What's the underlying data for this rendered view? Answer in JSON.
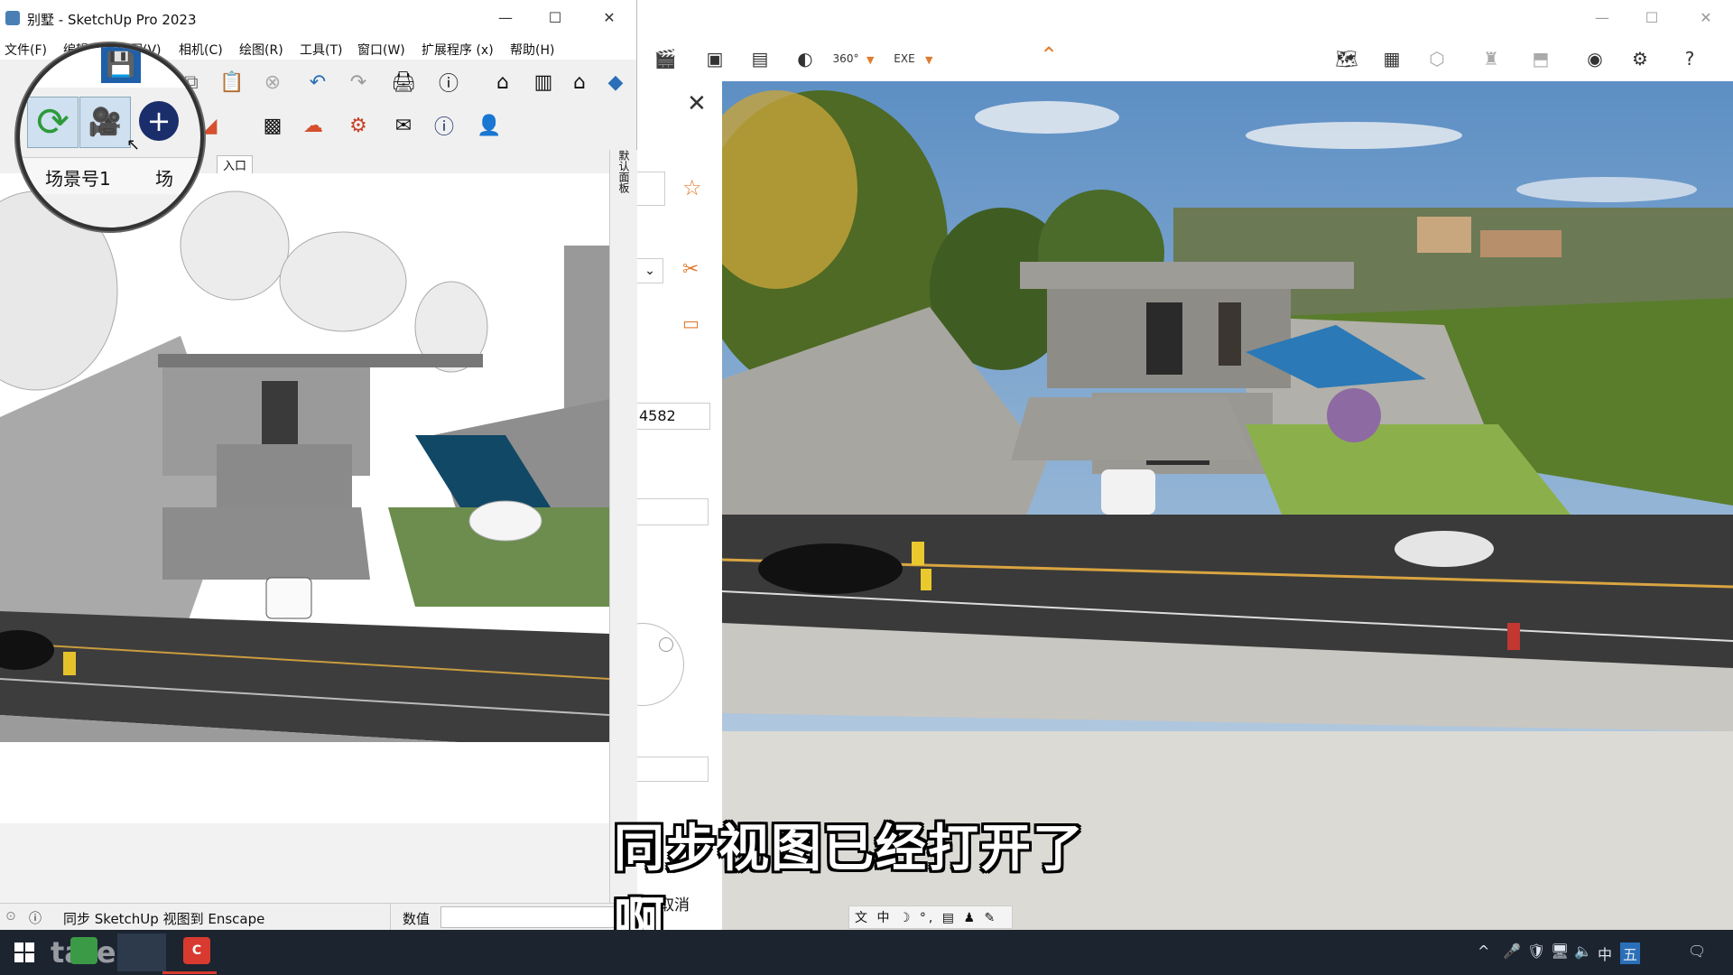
{
  "sketchup": {
    "title": "别墅 - SketchUp Pro 2023",
    "menu": [
      "文件(F)",
      "编辑",
      "视图(V)",
      "相机(C)",
      "绘图(R)",
      "工具(T)",
      "窗口(W)",
      "扩展程序 (x)",
      "帮助(H)"
    ],
    "scene_tabs": [
      "场景号1",
      "场",
      "入口"
    ],
    "side_panel_label": "默认面板",
    "status_text": "同步 SketchUp 视图到 Enscape",
    "value_label": "数值",
    "value_input": ""
  },
  "magnifier": {
    "tab1": "场景号1",
    "tab2": "场"
  },
  "panel": {
    "number_field": "4582",
    "cancel_label": "取消"
  },
  "subtitle": "同步视图已经打开了啊",
  "ime": {
    "chars": "中",
    "glyphs": "⽂ 中 ☽ °, ▤ ♟ ✎"
  },
  "taskbar": {
    "watermark": "tafe.cc",
    "tray_lang": "中",
    "tray_ime": "五"
  },
  "colors": {
    "accent_orange": "#e07b2e",
    "taskbar_bg": "#1c2430",
    "sketchup_red": "#d83a2f"
  }
}
